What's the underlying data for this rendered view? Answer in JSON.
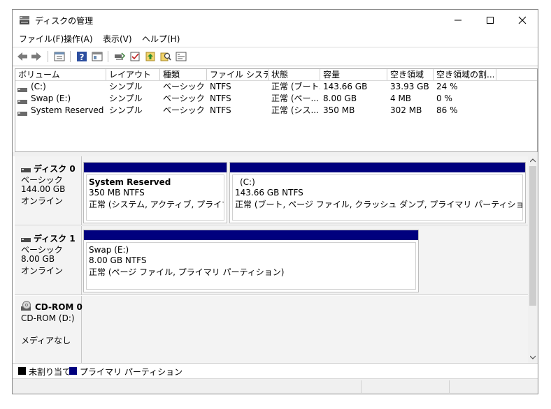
{
  "window": {
    "title": "ディスクの管理"
  },
  "menu": [
    "ファイル(F)",
    "操作(A)",
    "表示(V)",
    "ヘルプ(H)"
  ],
  "toolbar": {
    "icons": [
      "back-icon",
      "forward-icon",
      "properties-icon",
      "help-icon",
      "show-hide-icon",
      "rescan-icon",
      "check-icon",
      "import-icon",
      "search-icon",
      "console-icon"
    ]
  },
  "volume_list": {
    "columns": [
      "ボリューム",
      "レイアウト",
      "種類",
      "ファイル システム",
      "状態",
      "容量",
      "空き領域",
      "空き領域の割..."
    ],
    "rows": [
      [
        "(C:)",
        "シンプル",
        "ベーシック",
        "NTFS",
        "正常 (ブート...",
        "143.66 GB",
        "33.93 GB",
        "24 %"
      ],
      [
        "Swap (E:)",
        "シンプル",
        "ベーシック",
        "NTFS",
        "正常 (ペー...",
        "8.00 GB",
        "4 MB",
        "0 %"
      ],
      [
        "System Reserved",
        "シンプル",
        "ベーシック",
        "NTFS",
        "正常 (シス...",
        "350 MB",
        "302 MB",
        "86 %"
      ]
    ]
  },
  "disks": [
    {
      "name": "ディスク 0",
      "type": "ベーシック",
      "size": "144.00 GB",
      "status": "オンライン",
      "partitions": [
        {
          "name": "System Reserved",
          "size": "350 MB NTFS",
          "status": "正常 (システム, アクティブ, プライマリ パーテ"
        },
        {
          "name": "(C:)",
          "size": "143.66 GB NTFS",
          "status": "正常 (ブート, ページ ファイル, クラッシュ ダンプ, プライマリ パーティション)"
        }
      ]
    },
    {
      "name": "ディスク 1",
      "type": "ベーシック",
      "size": "8.00 GB",
      "status": "オンライン",
      "partitions": [
        {
          "name": "Swap  (E:)",
          "size": "8.00 GB NTFS",
          "status": "正常 (ページ ファイル, プライマリ パーティション)"
        }
      ]
    },
    {
      "name": "CD-ROM 0",
      "type": "CD-ROM (D:)",
      "media": "メディアなし"
    }
  ],
  "legend": {
    "unallocated": "未割り当て",
    "primary": "プライマリ パーティション",
    "colors": {
      "unallocated": "#000000",
      "primary": "#00007e"
    }
  }
}
